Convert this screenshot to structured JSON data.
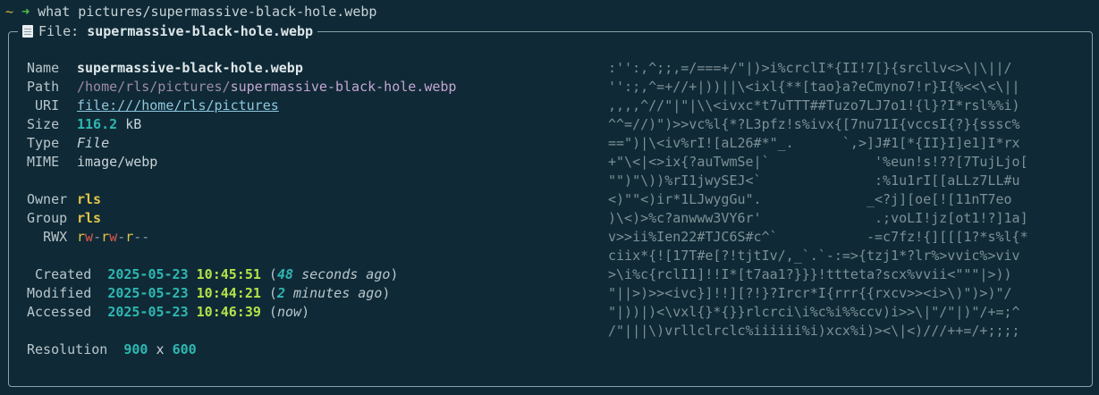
{
  "prompt": {
    "tilde": "~",
    "arrow": "➜",
    "command": "what pictures/supermassive-black-hole.webp"
  },
  "frame": {
    "title_prefix": "File:",
    "file_name": "supermassive-black-hole.webp"
  },
  "info": {
    "name_label": "Name",
    "name_value": "supermassive-black-hole.webp",
    "path_label": "Path",
    "path_dir": "/home/rls/pictures/",
    "path_file": "supermassive-black-hole.webp",
    "uri_label": "URI",
    "uri_value": "file:///home/rls/pictures",
    "size_label": "Size",
    "size_number": "116.2",
    "size_unit": "kB",
    "type_label": "Type",
    "type_value": "File",
    "mime_label": "MIME",
    "mime_value": "image/webp",
    "owner_label": "Owner",
    "owner_value": "rls",
    "group_label": "Group",
    "group_value": "rls",
    "rwx_label": "RWX",
    "created_label": "Created",
    "created_date": "2025-05-23",
    "created_time": "10:45:51",
    "created_rel_num": "48",
    "created_rel_text": "seconds ago",
    "modified_label": "Modified",
    "modified_date": "2025-05-23",
    "modified_time": "10:44:21",
    "modified_rel_num": "2",
    "modified_rel_text": "minutes ago",
    "accessed_label": "Accessed",
    "accessed_date": "2025-05-23",
    "accessed_time": "10:46:39",
    "accessed_rel_text": "now",
    "resolution_label": "Resolution",
    "res_width": "900",
    "res_x": "x",
    "res_height": "600"
  },
  "colors": {
    "background": "#0f2a36",
    "accent_teal": "#2fb7b2",
    "accent_yellow": "#e2c546",
    "accent_green": "#b6e24a",
    "perm_write": "#e0574e"
  },
  "ascii_art": [
    ":'':,^;;,=/===+/\"|)>i%crclI*{II!7[}{srcllv<>\\|\\||/",
    "'':;,^=+//+|))||\\<ixl{**[tao}a?eCmyno7!r}I{%<<\\<\\||",
    ",,,,^//\"|\"|\\\\<ivxc*t7uTTT##Tuzo7LJ7o1!{l}?I*rsl%%i)",
    "^^=//)\")>>vc%l{*?L3pfz!s%ivx{[7nu71I{vccsI{?}{sssc%",
    "==\")|\\<iv%rI![aL26#*\"_.      `,>]J#1[*{II}I]e1]I*rx",
    "+\"\\<|<>ix{?auTwmSe|`             '%eun!s!??[7TujLjo[",
    "\"\")\"\\))%rI1jwySEJ<`              :%1u1rI[[aLLz7LL#u",
    "<)\"\"<)ir*1LJwygGu\".             _<?j][oe[![11nT7eo",
    ")\\<)>%c?anwww3VY6r'              .;voLI!jz[ot1!?]1a]",
    "v>>ii%Ien22#TJC6S#c^`           -=c7fz!{][[[1?*s%l{*",
    "ciix*{![17T#e[?!tjtIv/,_`.`-:=>{tzj1*?lr%>vvic%>viv",
    ">\\i%c{rclI1]!!I*[t7aa1?}}}!ttteta?scx%vvii<\"\"\"|>))",
    "\"||>)>><ivc}]!!][?!}?Ircr*I{rrr{{rxcv>><i>\\)\")>)\"/",
    "\"|))|)<\\vxl{}*{}}rlcrci\\i%c%i%%ccv)i>>\\|\"/\"|)\"/+=;^",
    "/\"|||\\)vrllclrclc%iiiiii%i)xcx%i)><\\|<)///++=/+;;;;"
  ]
}
